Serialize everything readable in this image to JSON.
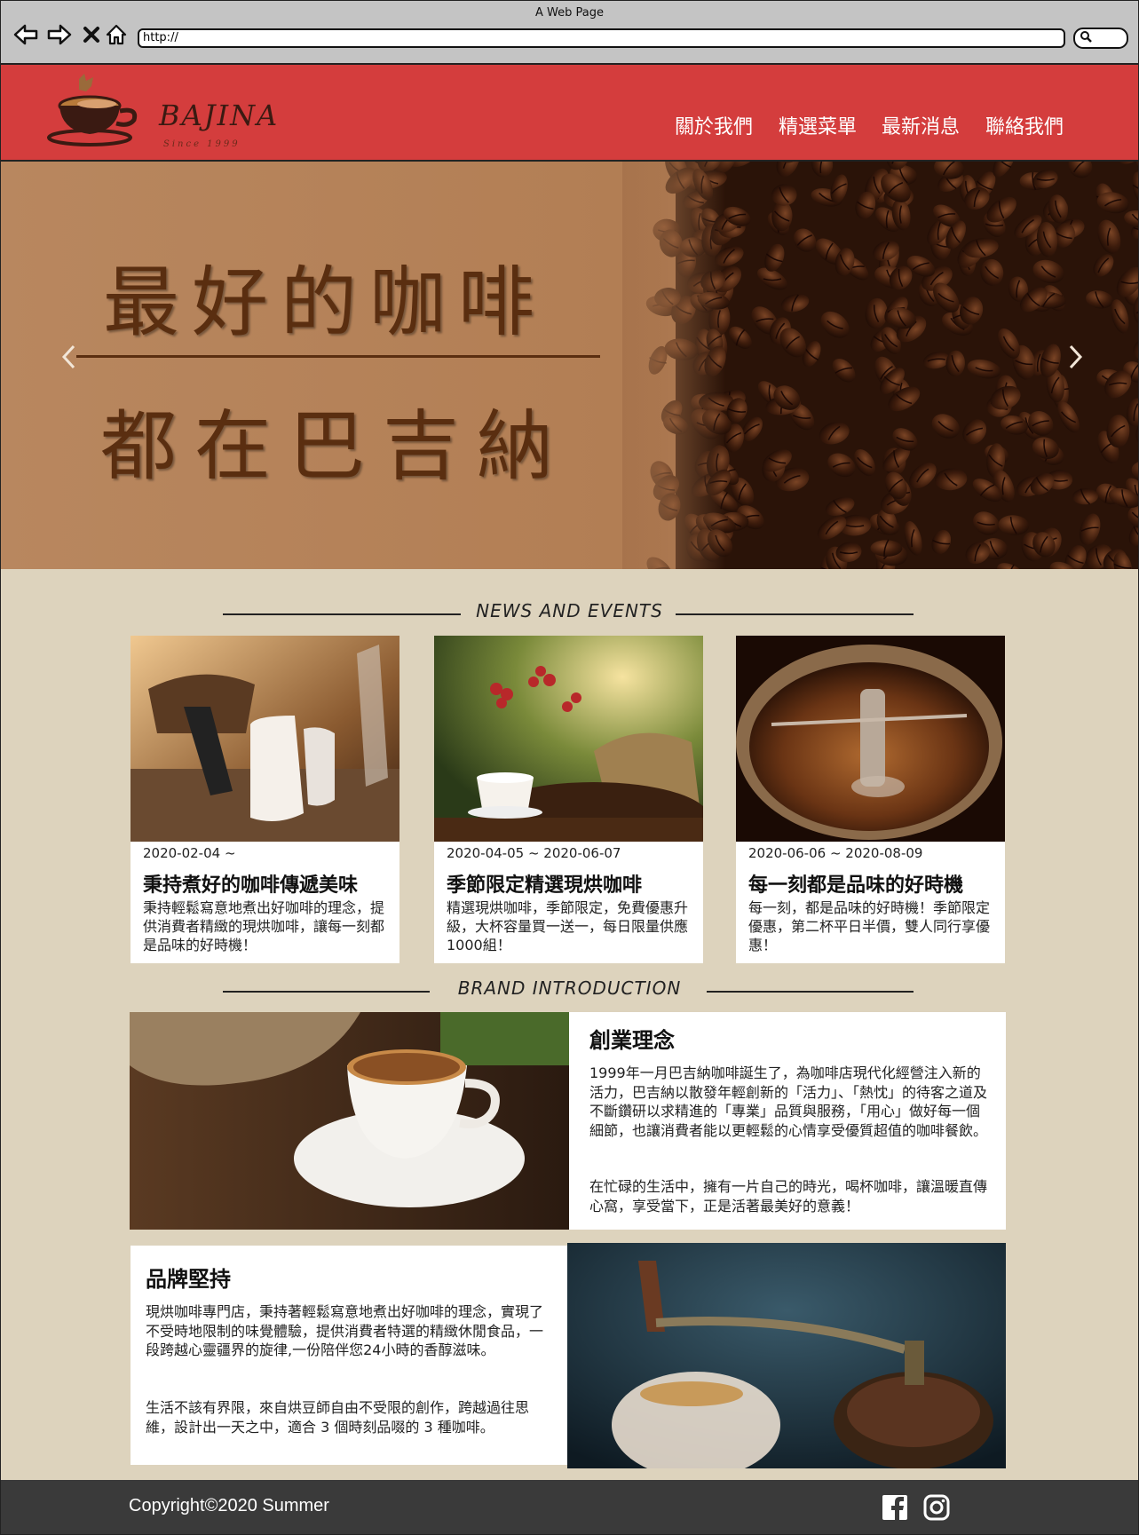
{
  "browser": {
    "title": "A Web Page",
    "url": "http://",
    "nav_icons": [
      "back-arrow-icon",
      "forward-arrow-icon",
      "close-icon",
      "home-icon"
    ],
    "search_icon": "search-icon"
  },
  "brand": {
    "name": "BAJINA",
    "since": "Since 1999"
  },
  "menu": [
    "關於我們",
    "精選菜單",
    "最新消息",
    "聯絡我們"
  ],
  "hero": {
    "line1": "最好的咖啡",
    "line2": "都在巴吉納",
    "prev_icon": "chevron-left-icon",
    "next_icon": "chevron-right-icon"
  },
  "news": {
    "title": "NEWS AND EVENTS",
    "cards": [
      {
        "date": "2020-02-04 ~",
        "title": "秉持煮好的咖啡傳遞美味",
        "desc": "秉持輕鬆寫意地煮出好咖啡的理念，提供消費者精緻的現烘咖啡，讓每一刻都是品味的好時機！"
      },
      {
        "date": "2020-04-05 ~ 2020-06-07",
        "title": "季節限定精選現烘咖啡",
        "desc": "精選現烘咖啡，季節限定，免費優惠升級，大杯容量買一送一，每日限量供應1000組！"
      },
      {
        "date": "2020-06-06 ~ 2020-08-09",
        "title": "每一刻都是品味的好時機",
        "desc": "每一刻，都是品味的好時機！季節限定優惠，第二杯平日半價，雙人同行享優惠！"
      }
    ]
  },
  "brand_intro": {
    "title": "BRAND INTRODUCTION",
    "block1": {
      "heading": "創業理念",
      "p1": "1999年一月巴吉納咖啡誕生了，為咖啡店現代化經營注入新的活力，巴吉納以散發年輕創新的「活力」、「熱忱」的待客之道及不斷鑽研以求精進的「專業」品質與服務，「用心」做好每一個細節，也讓消費者能以更輕鬆的心情享受優質超值的咖啡餐飲。",
      "p2": "在忙碌的生活中，擁有一片自己的時光，喝杯咖啡，讓溫暖直傳心窩，享受當下，正是活著最美好的意義！"
    },
    "block2": {
      "heading": "品牌堅持",
      "p1": "現烘咖啡專門店，秉持著輕鬆寫意地煮出好咖啡的理念，實現了不受時地限制的味覺體驗，提供消費者特選的精緻休閒食品，一段跨越心靈疆界的旋律,一份陪伴您24小時的香醇滋味。",
      "p2": "生活不該有界限，來自烘豆師自由不受限的創作，跨越過往思維，設計出一天之中，適合 3 個時刻品啜的 3 種咖啡。"
    }
  },
  "footer": {
    "copyright": "Copyright©2020 Summer",
    "icons": [
      "facebook-icon",
      "instagram-icon"
    ]
  }
}
